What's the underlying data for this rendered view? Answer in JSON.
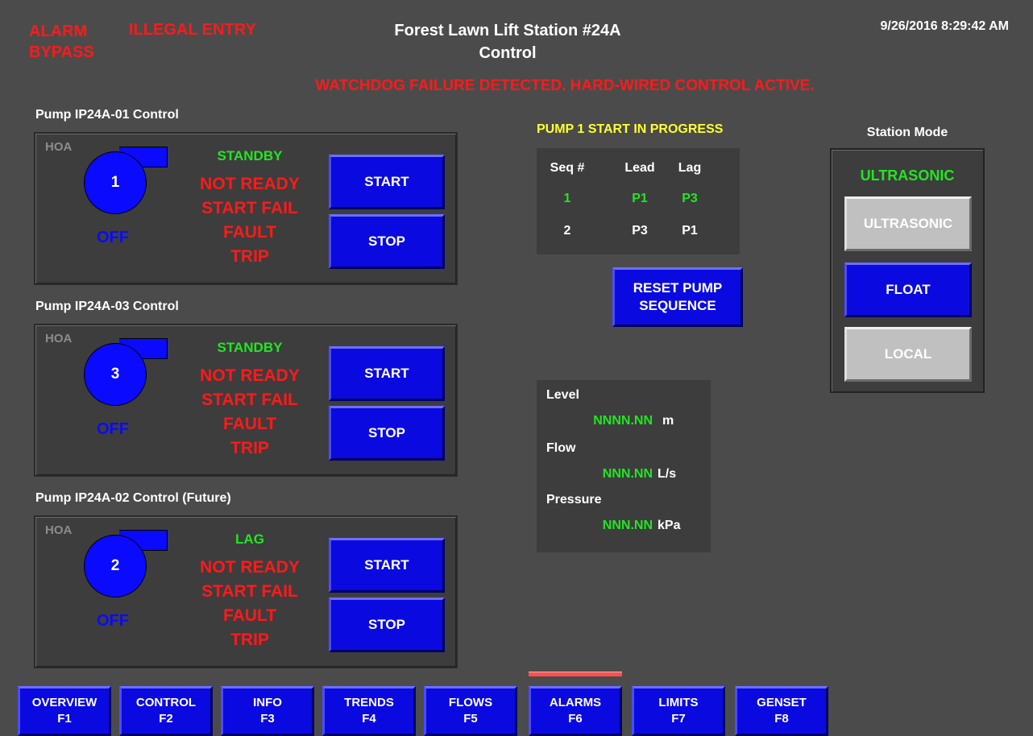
{
  "header": {
    "alarm_bypass_line1": "ALARM",
    "alarm_bypass_line2": "BYPASS",
    "illegal_entry": "ILLEGAL ENTRY",
    "title_line1": "Forest Lawn Lift Station #24A",
    "title_line2": "Control",
    "datetime": "9/26/2016 8:29:42 AM",
    "watchdog": "WATCHDOG FAILURE DETECTED. HARD-WIRED CONTROL ACTIVE."
  },
  "pumps": [
    {
      "title": "Pump IP24A-01 Control",
      "hoa": "HOA",
      "number": "1",
      "state": "OFF",
      "mode": "STANDBY",
      "status": [
        "NOT READY",
        "START FAIL",
        "FAULT",
        "TRIP"
      ],
      "start_label": "START",
      "stop_label": "STOP"
    },
    {
      "title": "Pump IP24A-03 Control",
      "hoa": "HOA",
      "number": "3",
      "state": "OFF",
      "mode": "STANDBY",
      "status": [
        "NOT READY",
        "START FAIL",
        "FAULT",
        "TRIP"
      ],
      "start_label": "START",
      "stop_label": "STOP"
    },
    {
      "title": "Pump IP24A-02 Control (Future)",
      "hoa": "HOA",
      "number": "2",
      "state": "OFF",
      "mode": "LAG",
      "status": [
        "NOT READY",
        "START FAIL",
        "FAULT",
        "TRIP"
      ],
      "start_label": "START",
      "stop_label": "STOP"
    }
  ],
  "sequence": {
    "message": "PUMP 1 START IN PROGRESS",
    "headers": [
      "Seq #",
      "Lead",
      "Lag"
    ],
    "rows": [
      [
        "1",
        "P1",
        "P3"
      ],
      [
        "2",
        "P3",
        "P1"
      ]
    ],
    "reset_label_line1": "RESET PUMP",
    "reset_label_line2": "SEQUENCE"
  },
  "measurements": {
    "level_label": "Level",
    "level_value": "NNNN.NN",
    "level_unit": "m",
    "flow_label": "Flow",
    "flow_value": "NNN.NN",
    "flow_unit": "L/s",
    "pressure_label": "Pressure",
    "pressure_value": "NNN.NN",
    "pressure_unit": "kPa"
  },
  "station_mode": {
    "title": "Station Mode",
    "current": "ULTRASONIC",
    "buttons": [
      "ULTRASONIC",
      "FLOAT",
      "LOCAL"
    ]
  },
  "nav": [
    {
      "label": "OVERVIEW",
      "key": "F1"
    },
    {
      "label": "CONTROL",
      "key": "F2"
    },
    {
      "label": "INFO",
      "key": "F3"
    },
    {
      "label": "TRENDS",
      "key": "F4"
    },
    {
      "label": "FLOWS",
      "key": "F5"
    },
    {
      "label": "ALARMS",
      "key": "F6"
    },
    {
      "label": "LIMITS",
      "key": "F7"
    },
    {
      "label": "GENSET",
      "key": "F8"
    }
  ],
  "colors": {
    "background": "#4b4b4b",
    "panel": "#3d3d3d",
    "button_blue": "#0a0ae0",
    "alarm_red": "#ff1a1a",
    "ok_green": "#22e622",
    "message_yellow": "#ffff33",
    "alarm_indicator": "#ff5050"
  }
}
